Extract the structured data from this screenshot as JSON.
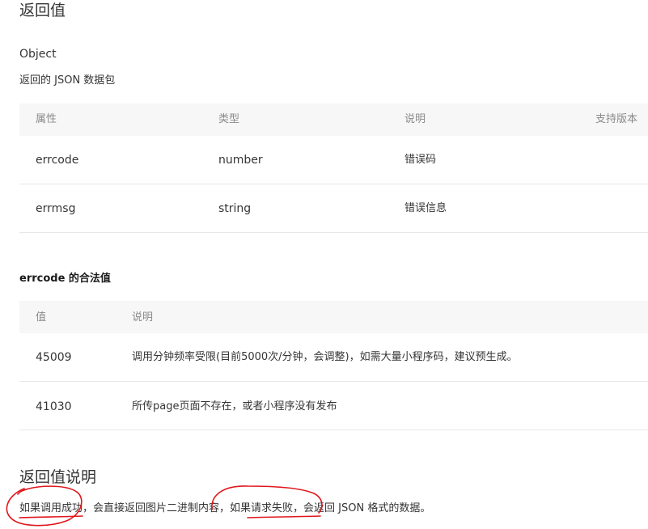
{
  "section1": {
    "title": "返回值",
    "type": "Object",
    "desc": "返回的 JSON 数据包"
  },
  "table1": {
    "headers": [
      "属性",
      "类型",
      "说明",
      "支持版本"
    ],
    "rows": [
      [
        "errcode",
        "number",
        "错误码"
      ],
      [
        "errmsg",
        "string",
        "错误信息"
      ]
    ]
  },
  "errcode_title": "errcode 的合法值",
  "table2": {
    "headers": [
      "值",
      "说明"
    ],
    "rows": [
      [
        "45009",
        "调用分钟频率受限(目前5000次/分钟，会调整)，如需大量小程序码，建议预生成。"
      ],
      [
        "41030",
        "所传page页面不存在，或者小程序没有发布"
      ]
    ]
  },
  "section2": {
    "title": "返回值说明",
    "sentence_parts": [
      "如果调用成功",
      "，会直接返回图片二进制内容，",
      "如果请求失败",
      "，会返回 JSON 格式的数据。"
    ]
  },
  "annotation_color": "#e0161c"
}
